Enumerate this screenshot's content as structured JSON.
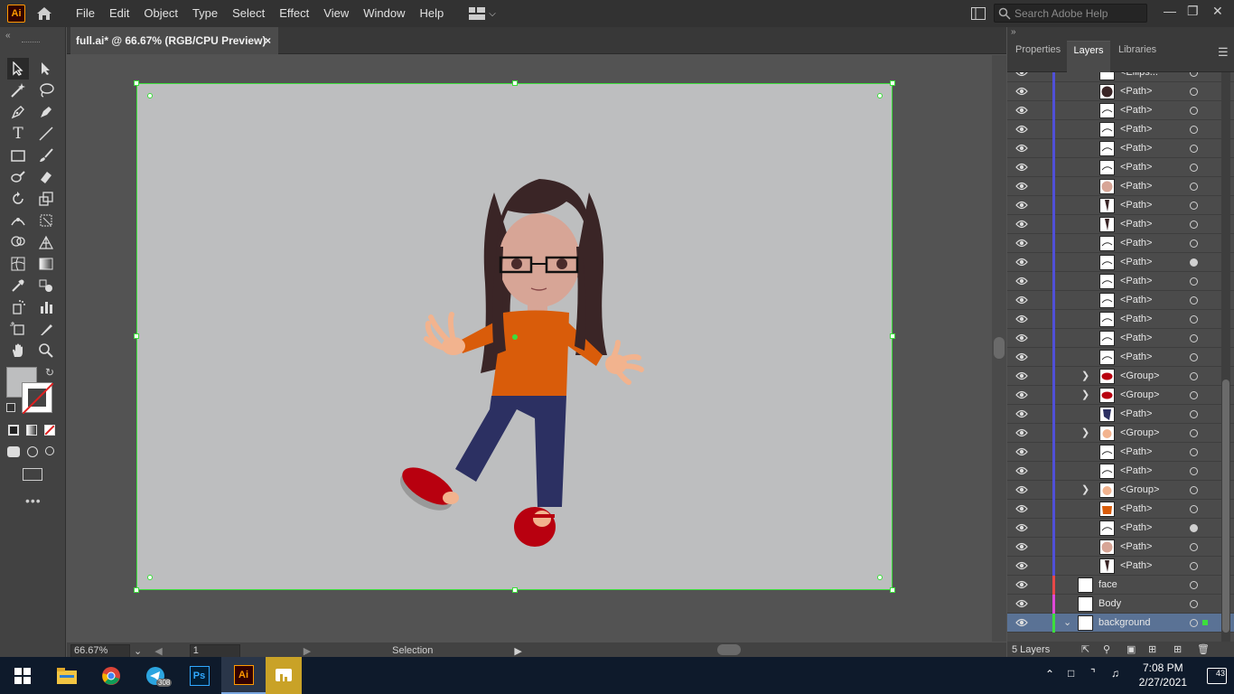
{
  "menubar": {
    "app_logo": "Ai",
    "items": [
      "File",
      "Edit",
      "Object",
      "Type",
      "Select",
      "Effect",
      "View",
      "Window",
      "Help"
    ],
    "search_placeholder": "Search Adobe Help"
  },
  "document": {
    "tab_title": "full.ai* @ 66.67% (RGB/CPU Preview)",
    "close_icon": "×"
  },
  "status": {
    "zoom": "66.67%",
    "artboard_number": "1",
    "tool_name": "Selection"
  },
  "panel": {
    "tabs": [
      "Properties",
      "Layers",
      "Libraries"
    ],
    "active_tab": "Layers",
    "sublayers": [
      {
        "name": "<Ellips...",
        "expand": false,
        "target": false,
        "thumb": "white"
      },
      {
        "name": "<Path>",
        "expand": false,
        "target": false,
        "thumb": "dark-circle"
      },
      {
        "name": "<Path>",
        "expand": false,
        "target": false,
        "thumb": "line"
      },
      {
        "name": "<Path>",
        "expand": false,
        "target": false,
        "thumb": "line"
      },
      {
        "name": "<Path>",
        "expand": false,
        "target": false,
        "thumb": "line"
      },
      {
        "name": "<Path>",
        "expand": false,
        "target": false,
        "thumb": "line"
      },
      {
        "name": "<Path>",
        "expand": false,
        "target": false,
        "thumb": "skin"
      },
      {
        "name": "<Path>",
        "expand": false,
        "target": false,
        "thumb": "hair"
      },
      {
        "name": "<Path>",
        "expand": false,
        "target": false,
        "thumb": "hair"
      },
      {
        "name": "<Path>",
        "expand": false,
        "target": false,
        "thumb": "line"
      },
      {
        "name": "<Path>",
        "expand": false,
        "target": true,
        "thumb": "line"
      },
      {
        "name": "<Path>",
        "expand": false,
        "target": false,
        "thumb": "line"
      },
      {
        "name": "<Path>",
        "expand": false,
        "target": false,
        "thumb": "line"
      },
      {
        "name": "<Path>",
        "expand": false,
        "target": false,
        "thumb": "line"
      },
      {
        "name": "<Path>",
        "expand": false,
        "target": false,
        "thumb": "line"
      },
      {
        "name": "<Path>",
        "expand": false,
        "target": false,
        "thumb": "line"
      },
      {
        "name": "<Group>",
        "expand": true,
        "target": false,
        "thumb": "shoe"
      },
      {
        "name": "<Group>",
        "expand": true,
        "target": false,
        "thumb": "shoe"
      },
      {
        "name": "<Path>",
        "expand": false,
        "target": false,
        "thumb": "jeans"
      },
      {
        "name": "<Group>",
        "expand": true,
        "target": false,
        "thumb": "hand"
      },
      {
        "name": "<Path>",
        "expand": false,
        "target": false,
        "thumb": "line"
      },
      {
        "name": "<Path>",
        "expand": false,
        "target": false,
        "thumb": "line"
      },
      {
        "name": "<Group>",
        "expand": true,
        "target": false,
        "thumb": "hand"
      },
      {
        "name": "<Path>",
        "expand": false,
        "target": false,
        "thumb": "shirt"
      },
      {
        "name": "<Path>",
        "expand": false,
        "target": true,
        "thumb": "line"
      },
      {
        "name": "<Path>",
        "expand": false,
        "target": false,
        "thumb": "skin"
      },
      {
        "name": "<Path>",
        "expand": false,
        "target": false,
        "thumb": "hair"
      }
    ],
    "layers": [
      {
        "name": "face",
        "color": "#e74848"
      },
      {
        "name": "Body",
        "color": "#e048d8"
      },
      {
        "name": "background",
        "color": "#3cde3c"
      }
    ],
    "layer_count": "5 Layers"
  },
  "taskbar": {
    "time": "7:08 PM",
    "date": "2/27/2021",
    "telegram_badge": "308",
    "notifications": "43",
    "ps_label": "Ps",
    "ai_label": "Ai"
  },
  "colors": {
    "accent_green": "#3cde3c",
    "layer_blue": "#5050d8",
    "artboard_bg": "#bdbebf"
  }
}
